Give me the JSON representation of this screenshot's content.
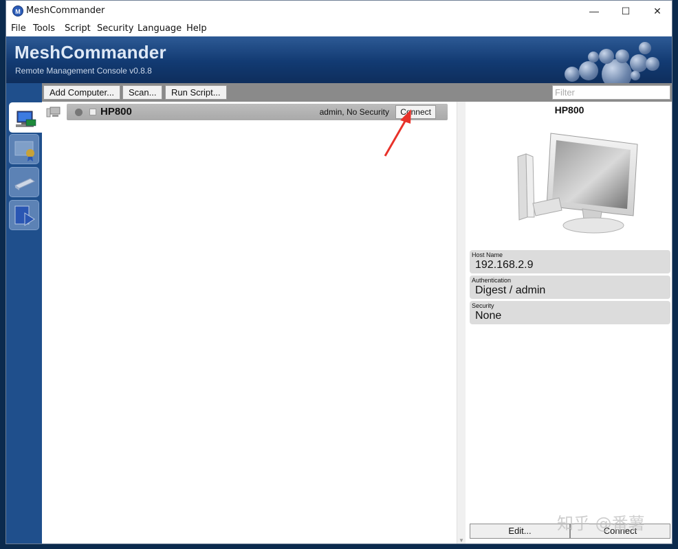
{
  "window": {
    "title": "MeshCommander",
    "app_icon_letter": "M",
    "controls": {
      "minimize": "—",
      "maximize": "☐",
      "close": "✕"
    }
  },
  "menu": [
    "File",
    "Tools",
    "Script",
    "Security",
    "Language",
    "Help"
  ],
  "banner": {
    "title": "MeshCommander",
    "subtitle": "Remote Management Console v0.8.8"
  },
  "toolbar": {
    "add_computer": "Add Computer...",
    "scan": "Scan...",
    "run_script": "Run Script...",
    "filter_placeholder": "Filter"
  },
  "computers": [
    {
      "name": "HP800",
      "info": "admin, No Security",
      "connect_label": "Connect"
    }
  ],
  "detail": {
    "title": "HP800",
    "fields": [
      {
        "label": "Host Name",
        "value": "192.168.2.9"
      },
      {
        "label": "Authentication",
        "value": "Digest / admin"
      },
      {
        "label": "Security",
        "value": "None"
      }
    ],
    "edit_label": "Edit...",
    "connect_label": "Connect"
  },
  "watermark": "知乎 @番薯",
  "colors": {
    "banner": "#123a72",
    "rail": "#1f4f8c",
    "annotation_arrow": "#e8322a"
  }
}
